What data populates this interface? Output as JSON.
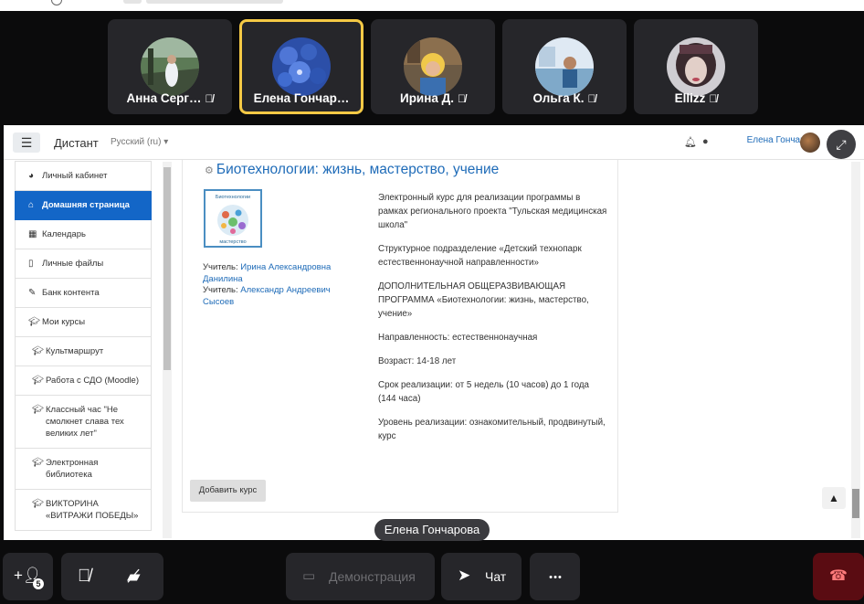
{
  "participants": [
    {
      "name": "Анна Серг…",
      "muted": true,
      "active": false
    },
    {
      "name": "Елена Гончар…",
      "muted": false,
      "active": true
    },
    {
      "name": "Ирина Д.",
      "muted": true,
      "active": false
    },
    {
      "name": "Ольга К.",
      "muted": true,
      "active": false
    },
    {
      "name": "Ellizz",
      "muted": true,
      "active": false
    }
  ],
  "shared_screen": {
    "site": "Дистант",
    "language": "Русский (ru) ▾",
    "user_name": "Елена Гончарова",
    "sidebar": [
      {
        "label": "Личный кабинет",
        "icon": "dashboard-icon"
      },
      {
        "label": "Домашняя страница",
        "icon": "home-icon",
        "active": true
      },
      {
        "label": "Календарь",
        "icon": "calendar-icon"
      },
      {
        "label": "Личные файлы",
        "icon": "file-icon"
      },
      {
        "label": "Банк контента",
        "icon": "brush-icon"
      },
      {
        "label": "Мои курсы",
        "icon": "graduation-cap-icon"
      },
      {
        "label": "Культмаршрут",
        "icon": "graduation-cap-icon"
      },
      {
        "label": "Работа с СДО (Moodle)",
        "icon": "graduation-cap-icon"
      },
      {
        "label": "Классный час \"Не смолкнет слава тех великих лет\"",
        "icon": "graduation-cap-icon"
      },
      {
        "label": "Электронная библиотека",
        "icon": "graduation-cap-icon"
      },
      {
        "label": "ВИКТОРИНА «ВИТРАЖИ ПОБЕДЫ»",
        "icon": "graduation-cap-icon"
      }
    ],
    "course": {
      "title": "Биотехнологии: жизнь, мастерство, учение",
      "image_caption_top": "Биотехнологии",
      "image_caption_bottom": "мастерство",
      "teacher_label": "Учитель:",
      "teachers": [
        "Ирина Александровна Данилина",
        "Александр Андреевич Сысоев"
      ],
      "description": [
        "Электронный курс для реализации программы в рамках регионального проекта \"Тульская медицинская школа\"",
        "Структурное подразделение «Детский технопарк естественнонаучной направленности»",
        "ДОПОЛНИТЕЛЬНАЯ ОБЩЕРАЗВИВАЮЩАЯ ПРОГРАММА «Биотехнологии: жизнь, мастерство, учение»",
        "Направленность: естественнонаучная",
        "Возраст: 14-18 лет",
        "Срок реализации: от 5 недель (10 часов) до 1 года (144 часа)",
        "Уровень реализации: ознакомительный, продвинутый, курс"
      ]
    },
    "add_course_label": "Добавить курс"
  },
  "presenter_label": "Елена Гончарова",
  "controls": {
    "participants_count": "5",
    "demo_label": "Демонстрация",
    "chat_label": "Чат",
    "more_label": "• • •"
  },
  "colors": {
    "active_tile_border": "#f4c945",
    "moodle_blue": "#1366c7",
    "hangup": "#5a0c12"
  }
}
